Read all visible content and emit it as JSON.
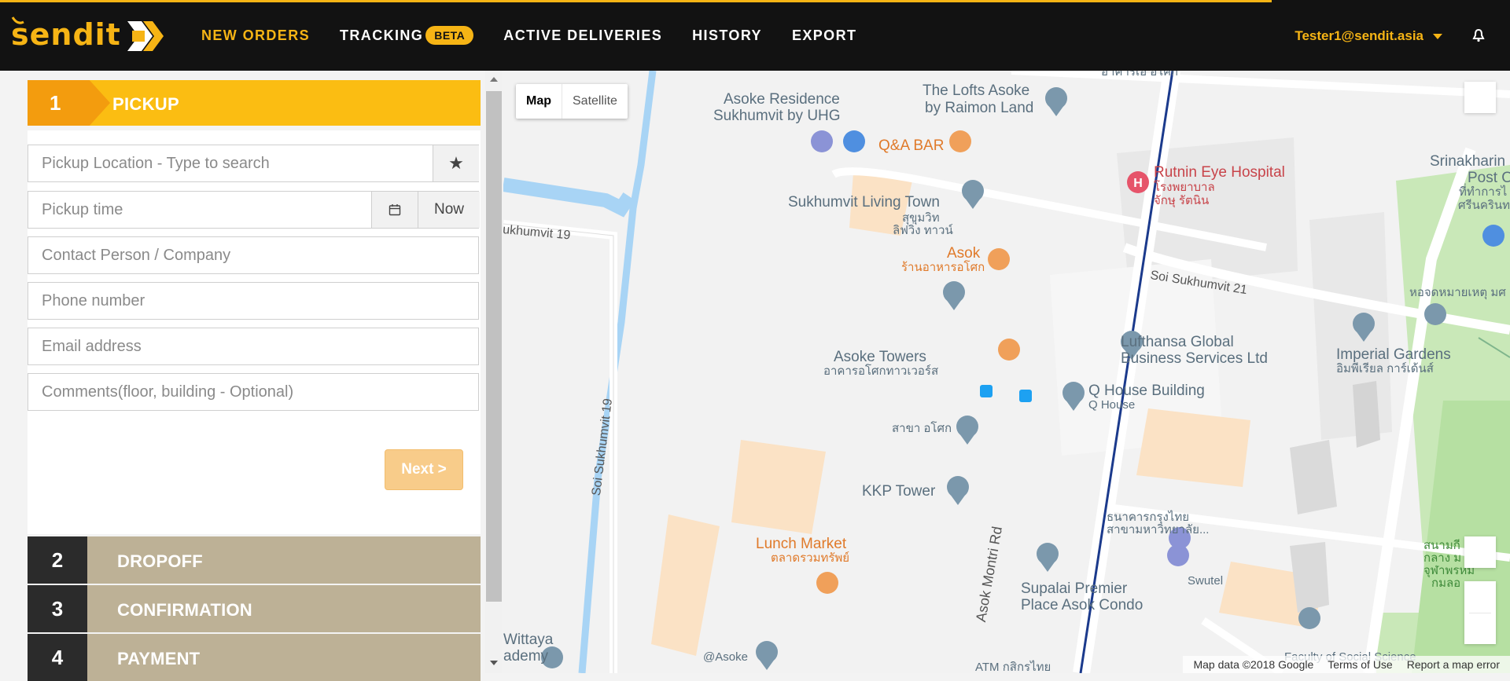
{
  "header": {
    "logo_text": "sendit",
    "nav": [
      {
        "label": "NEW ORDERS"
      },
      {
        "label": "TRACKING",
        "badge": "BETA"
      },
      {
        "label": "ACTIVE DELIVERIES"
      },
      {
        "label": "HISTORY"
      },
      {
        "label": "EXPORT"
      }
    ],
    "user_email": "Tester1@sendit.asia",
    "colors": {
      "accent": "#f6b415",
      "bar": "#121212"
    }
  },
  "pickup": {
    "step_number": "1",
    "step_title": "PICKUP",
    "location_placeholder": "Pickup Location - Type to search",
    "time_placeholder": "Pickup time",
    "now_label": "Now",
    "contact_placeholder": "Contact Person / Company",
    "phone_placeholder": "Phone number",
    "email_placeholder": "Email address",
    "comments_placeholder": "Comments(floor, building - Optional)",
    "next_label": "Next >",
    "favorite_icon": "star-icon",
    "calendar_icon": "calendar-icon"
  },
  "steps": [
    {
      "number": "2",
      "title": "DROPOFF"
    },
    {
      "number": "3",
      "title": "CONFIRMATION"
    },
    {
      "number": "4",
      "title": "PAYMENT"
    }
  ],
  "map": {
    "map_label": "Map",
    "satellite_label": "Satellite",
    "labels": {
      "asoke_residence_1": "Asoke Residence",
      "asoke_residence_2": "Sukhumvit by UHG",
      "lofts_1": "The Lofts Asoke",
      "lofts_2": "by Raimon Land",
      "qa_bar": "Q&A BAR",
      "rutnin_1": "Rutnin Eye Hospital",
      "rutnin_2": "โรงพยาบาล",
      "rutnin_3": "จักษุ รัตนิน",
      "srinakharin_1": "Srinakharin",
      "srinakharin_2": "Post O",
      "srinakharin_3": "ที่ทำการไ",
      "srinakharin_4": "ศรีนครินท",
      "living_town_1": "Sukhumvit Living Town",
      "living_town_2": "สุขุมวิท",
      "living_town_3": "ลิฟวิ่ง ทาวน์",
      "sukhumvit19_road": "ukhumvit 19",
      "asok_1": "Asok",
      "asok_2": "ร้านอาหารอโศก",
      "soi21": "Soi Sukhumvit 21",
      "library": "หอจดหมายเหตุ มศ",
      "asoke_towers_1": "Asoke Towers",
      "asoke_towers_2": "อาคารอโศกทาวเวอร์ส",
      "lufthansa_1": "Lufthansa Global",
      "lufthansa_2": "Business Services Ltd",
      "imperial_1": "Imperial Gardens",
      "imperial_2": "อิมพีเรียล การ์เด้นส์",
      "q_house_1": "Q House Building",
      "q_house_2": "Q House",
      "saka_asok": "สาขา อโศก",
      "soi19_vertical": "Soi Sukhumvit 19",
      "kkp": "KKP Tower",
      "bank_1": "ธนาคารกรุงไทย",
      "bank_2": "สาขามหาวิทยาลัย...",
      "lunch_1": "Lunch Market",
      "lunch_2": "ตลาดรวมทรัพย์",
      "asok_montri": "Asok Montri Rd",
      "supalai_1": "Supalai Premier",
      "supalai_2": "Place Asok Condo",
      "swutel": "Swutel",
      "stadium_1": "สนามกี",
      "stadium_2": "กลาง ม",
      "stadium_3": "จุฬาพรหม",
      "stadium_4": "กมลอ",
      "wittaya_1": "Wittaya",
      "wittaya_2": "ademy",
      "at_asoke": "@Asoke",
      "faculty": "Faculty of Social Science",
      "atm": "ATM กสิกรไทย",
      "partial_top": "อาคารเอ อโศก"
    },
    "footer": {
      "map_data": "Map data ©2018 Google",
      "terms": "Terms of Use",
      "report": "Report a map error"
    },
    "colors": {
      "road_line": "#1b3a8c",
      "canal": "#a8d4f5",
      "park": "#c9e8b8",
      "building": "#fbe2c5"
    }
  }
}
